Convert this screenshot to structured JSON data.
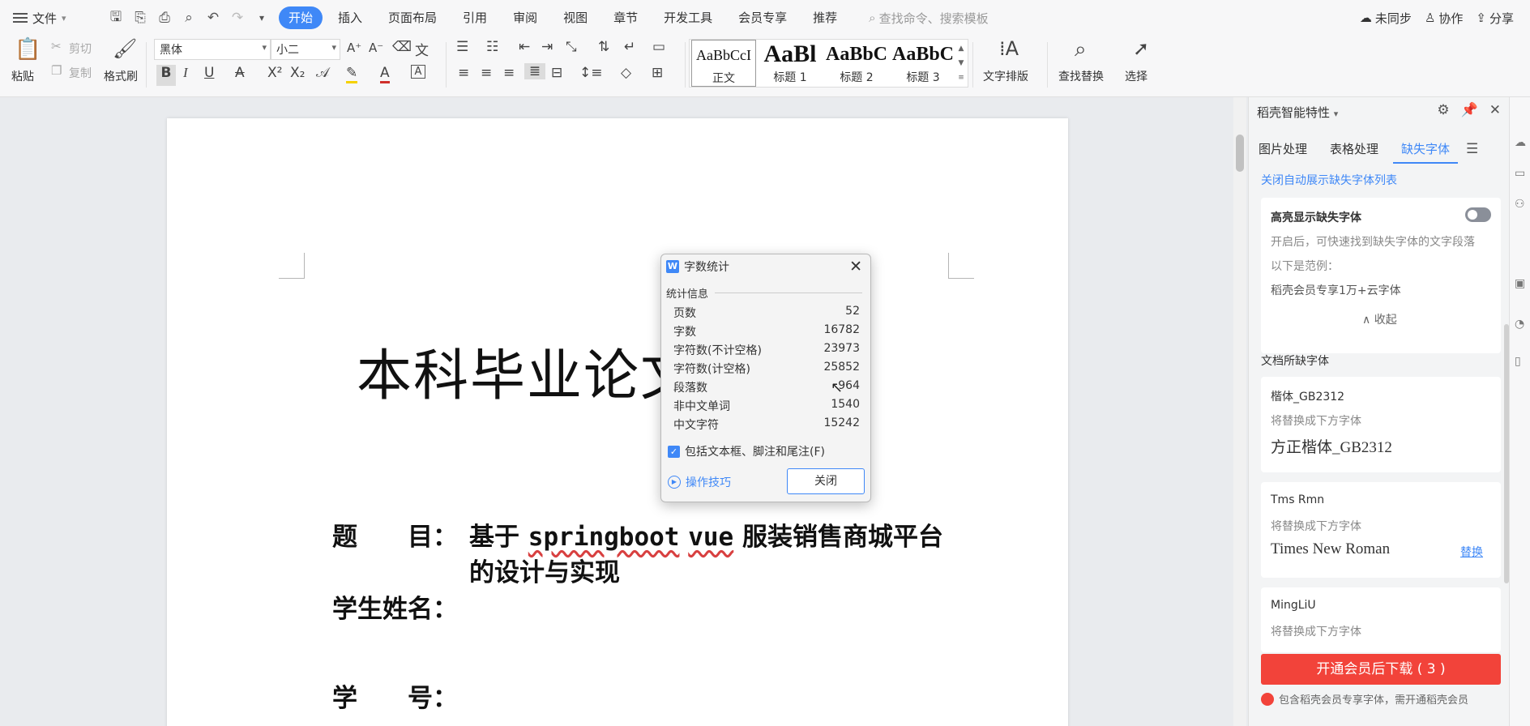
{
  "menubar": {
    "file": "文件",
    "tabs": [
      "开始",
      "插入",
      "页面布局",
      "引用",
      "审阅",
      "视图",
      "章节",
      "开发工具",
      "会员专享",
      "推荐"
    ],
    "search_placeholder": "查找命令、搜索模板",
    "sync": "未同步",
    "collab": "协作",
    "share": "分享"
  },
  "ribbon": {
    "paste": "粘贴",
    "cut": "剪切",
    "copy": "复制",
    "format_painter": "格式刷",
    "font_name": "黑体",
    "font_size": "小二",
    "styles": [
      {
        "sample": "AaBbCcI",
        "label": "正文"
      },
      {
        "sample": "AaBl",
        "label": "标题 1"
      },
      {
        "sample": "AaBbC",
        "label": "标题 2"
      },
      {
        "sample": "AaBbC",
        "label": "标题 3"
      }
    ],
    "text_layout": "文字排版",
    "find_replace": "查找替换",
    "select": "选择"
  },
  "document": {
    "title": "本科毕业论文",
    "topic_label": "题　　目：",
    "topic_line1_a": "基于",
    "topic_line1_b": "springboot",
    "topic_line1_c": "vue",
    "topic_line1_d": "服装销售商城平台",
    "topic_line2": "的设计与实现",
    "student_label": "学生姓名：",
    "id_label": "学　　号："
  },
  "dialog": {
    "title": "字数统计",
    "group": "统计信息",
    "stats": [
      {
        "label": "页数",
        "value": "52"
      },
      {
        "label": "字数",
        "value": "16782"
      },
      {
        "label": "字符数(不计空格)",
        "value": "23973"
      },
      {
        "label": "字符数(计空格)",
        "value": "25852"
      },
      {
        "label": "段落数",
        "value": "964"
      },
      {
        "label": "非中文单词",
        "value": "1540"
      },
      {
        "label": "中文字符",
        "value": "15242"
      }
    ],
    "checkbox": "包括文本框、脚注和尾注(F)",
    "tips": "操作技巧",
    "close": "关闭"
  },
  "panel": {
    "header": "稻壳智能特性",
    "tabs": [
      "图片处理",
      "表格处理",
      "缺失字体"
    ],
    "link": "关闭自动展示缺失字体列表",
    "highlight_title": "高亮显示缺失字体",
    "highlight_desc": "开启后，可快速找到缺失字体的文字段落",
    "example_label": "以下是范例：",
    "example_value": "稻壳会员专享1万+云字体",
    "collapse": "收起",
    "section": "文档所缺字体",
    "fonts": [
      {
        "name": "楷体_GB2312",
        "hint": "将替换成下方字体",
        "replacement": "方正楷体_GB2312",
        "action": ""
      },
      {
        "name": "Tms Rmn",
        "hint": "将替换成下方字体",
        "replacement": "Times New Roman",
        "action": "替换"
      },
      {
        "name": "MingLiU",
        "hint": "将替换成下方字体",
        "replacement": "",
        "action": ""
      }
    ],
    "download_btn": "开通会员后下载 ( 3 )",
    "note": "包含稻壳会员专享字体，需开通稻壳会员"
  },
  "colors": {
    "accent": "#3f88f7",
    "danger": "#f2433a"
  }
}
